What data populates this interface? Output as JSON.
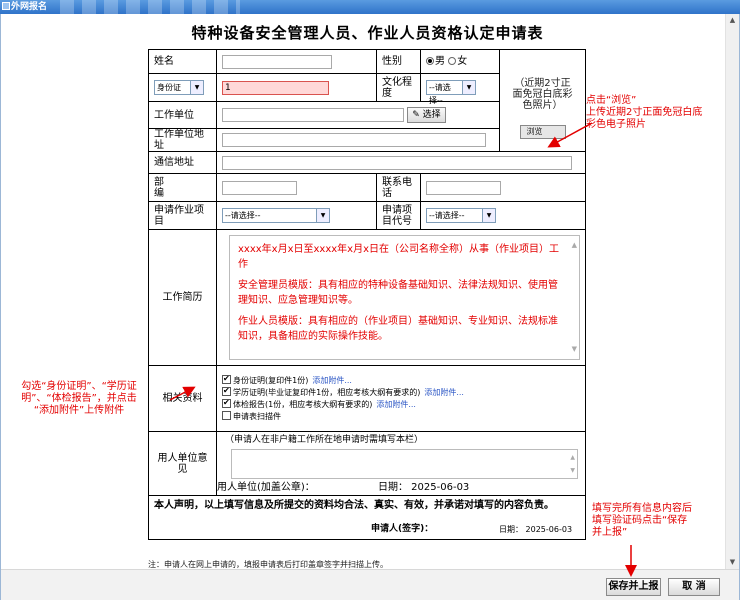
{
  "window": {
    "title": "外网报名"
  },
  "form": {
    "title": "特种设备安全管理人员、作业人员资格认定申请表",
    "name_label": "姓名",
    "gender_label": "性别",
    "gender_male": "男",
    "gender_female": "女",
    "id_type": "身份证",
    "id_value": "1",
    "education_label": "文化程度",
    "select_placeholder": "--请选择--",
    "photo_hint": "（近期2寸正面免冠白底彩色照片）",
    "browse_label": "浏览",
    "work_unit_label": "工作单位",
    "select_button_label": "选择",
    "work_address_label": "工作单位地址",
    "mail_address_label": "通信地址",
    "postcode_label": "部    编",
    "phone_label": "联系电话",
    "project_label": "申请作业项目",
    "project_code_label": "申请项目代号",
    "resume_label": "工作简历",
    "resume_lines": [
      "xxxx年x月x日至xxxx年x月x日在（公司名称全称）从事（作业项目）工作",
      "安全管理员模版：具有相应的特种设备基础知识、法律法规知识、使用管理知识、应急管理知识等。",
      "作业人员模版：具有相应的（作业项目）基础知识、专业知识、法规标准知识，具备相应的实际操作技能。"
    ],
    "materials_label": "相关资料",
    "attachments": [
      {
        "label": "身份证明(复印件1份)",
        "checked": true,
        "link": "添加附件..."
      },
      {
        "label": "学历证明(毕业证复印件1份，相应考核大纲有要求的)",
        "checked": true,
        "link": "添加附件..."
      },
      {
        "label": "体检报告(1份，相应考核大纲有要求的)",
        "checked": true,
        "link": "添加附件..."
      },
      {
        "label": "申请表扫描件",
        "checked": false,
        "link": ""
      }
    ],
    "opinion_label": "用人单位意见",
    "opinion_hint": "（申请人在非户籍工作所在地申请时需填写本栏）",
    "opinion_stamp": "用人单位(加盖公章)：",
    "opinion_date": "日期：  2025-06-03",
    "declaration": "本人声明，以上填写信息及所提交的资料均合法、真实、有效，并承诺对填写的内容负责。",
    "applicant_sign": "申请人(签字)：",
    "declaration_date": "日期：  2025-06-03",
    "note": "注：申请人在网上申请的，填报申请表后打印盖章签字并扫描上传。"
  },
  "buttons": {
    "save": "保存并上报",
    "cancel": "取 消"
  },
  "annotations": {
    "photo": "点击“浏览”\n上传近期2寸正面免冠白底\n彩色电子照片",
    "attach": "勾选“身份证明”、“学历证\n明”、“体检报告”，并点击\n“添加附件”上传附件",
    "save": "填写完所有信息内容后\n填写验证码点击“保存\n并上报”"
  },
  "colors": {
    "annotation": "#e30000",
    "titlebar": "#2f73c9",
    "link": "#2a55c5"
  }
}
